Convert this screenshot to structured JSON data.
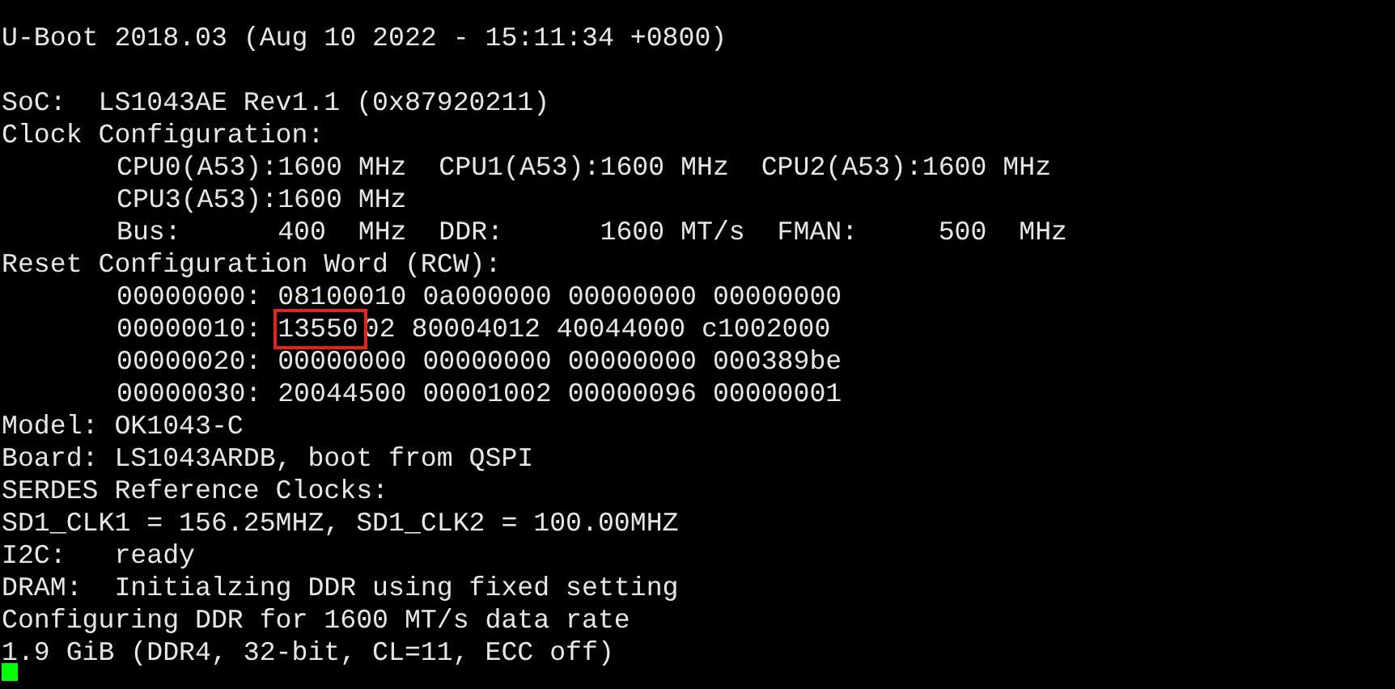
{
  "terminal": {
    "lines": [
      {
        "kind": "text",
        "text": "U-Boot 2018.03 (Aug 10 2022 - 15:11:34 +0800)"
      },
      {
        "kind": "blank"
      },
      {
        "kind": "text",
        "text": "SoC:  LS1043AE Rev1.1 (0x87920211)"
      },
      {
        "kind": "text",
        "text": "Clock Configuration:",
        "children": [
          {
            "kind": "text",
            "text": "CPU0(A53):1600 MHz  CPU1(A53):1600 MHz  CPU2(A53):1600 MHz"
          },
          {
            "kind": "text",
            "text": "CPU3(A53):1600 MHz"
          },
          {
            "kind": "text",
            "text": "Bus:      400  MHz  DDR:      1600 MT/s  FMAN:     500  MHz"
          }
        ]
      },
      {
        "kind": "text",
        "text": "Reset Configuration Word (RCW):",
        "children": [
          {
            "kind": "text",
            "text": "00000000: 08100010 0a000000 00000000 00000000"
          },
          {
            "kind": "marked",
            "before": "00000010: ",
            "marked": "13550",
            "after": "02 80004012 40044000 c1002000"
          },
          {
            "kind": "text",
            "text": "00000020: 00000000 00000000 00000000 000389be"
          },
          {
            "kind": "text",
            "text": "00000030: 20044500 00001002 00000096 00000001"
          }
        ]
      },
      {
        "kind": "text",
        "text": "Model: OK1043-C"
      },
      {
        "kind": "text",
        "text": "Board: LS1043ARDB, boot from QSPI"
      },
      {
        "kind": "text",
        "text": "SERDES Reference Clocks:"
      },
      {
        "kind": "text",
        "text": "SD1_CLK1 = 156.25MHZ, SD1_CLK2 = 100.00MHZ"
      },
      {
        "kind": "text",
        "text": "I2C:   ready"
      },
      {
        "kind": "text",
        "text": "DRAM:  Initialzing DDR using fixed setting"
      },
      {
        "kind": "text",
        "text": "Configuring DDR for 1600 MT/s data rate"
      },
      {
        "kind": "text",
        "text": "1.9 GiB (DDR4, 32-bit, CL=11, ECC off)"
      }
    ],
    "cursor_visible": true
  }
}
